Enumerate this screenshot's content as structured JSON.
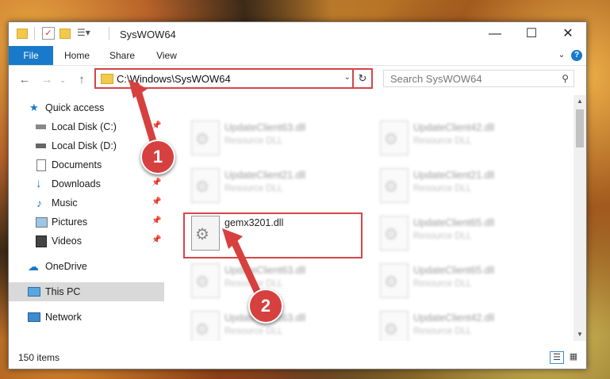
{
  "window": {
    "title": "SysWOW64"
  },
  "ribbon": {
    "file": "File",
    "home": "Home",
    "share": "Share",
    "view": "View"
  },
  "address": {
    "path": "C:\\Windows\\SysWOW64"
  },
  "search": {
    "placeholder": "Search SysWOW64"
  },
  "sidebar": {
    "items": [
      {
        "label": "Quick access"
      },
      {
        "label": "Local Disk (C:)"
      },
      {
        "label": "Local Disk (D:)"
      },
      {
        "label": "Documents"
      },
      {
        "label": "Downloads"
      },
      {
        "label": "Music"
      },
      {
        "label": "Pictures"
      },
      {
        "label": "Videos"
      },
      {
        "label": "OneDrive"
      },
      {
        "label": "This PC"
      },
      {
        "label": "Network"
      }
    ]
  },
  "files": [
    {
      "name": "UpdateClient63.dll",
      "type": "Resource DLL"
    },
    {
      "name": "UpdateClient42.dll",
      "type": "Resource DLL"
    },
    {
      "name": "UpdateClient21.dll",
      "type": "Resource DLL"
    },
    {
      "name": "UpdateClient21.dll",
      "type": "Resource DLL"
    },
    {
      "name": "gemx3201.dll",
      "type": ""
    },
    {
      "name": "UpdateClient65.dll",
      "type": "Resource DLL"
    },
    {
      "name": "UpdateClient63.dll",
      "type": "Resource DLL"
    },
    {
      "name": "UpdateClient65.dll",
      "type": "Resource DLL"
    },
    {
      "name": "UpdateClient63.dll",
      "type": "Resource DLL"
    },
    {
      "name": "UpdateClient42.dll",
      "type": "Resource DLL"
    }
  ],
  "status": {
    "count": "150 items"
  },
  "callouts": {
    "one": "1",
    "two": "2"
  },
  "colors": {
    "accent": "#1979ca",
    "highlight": "#d64548"
  }
}
